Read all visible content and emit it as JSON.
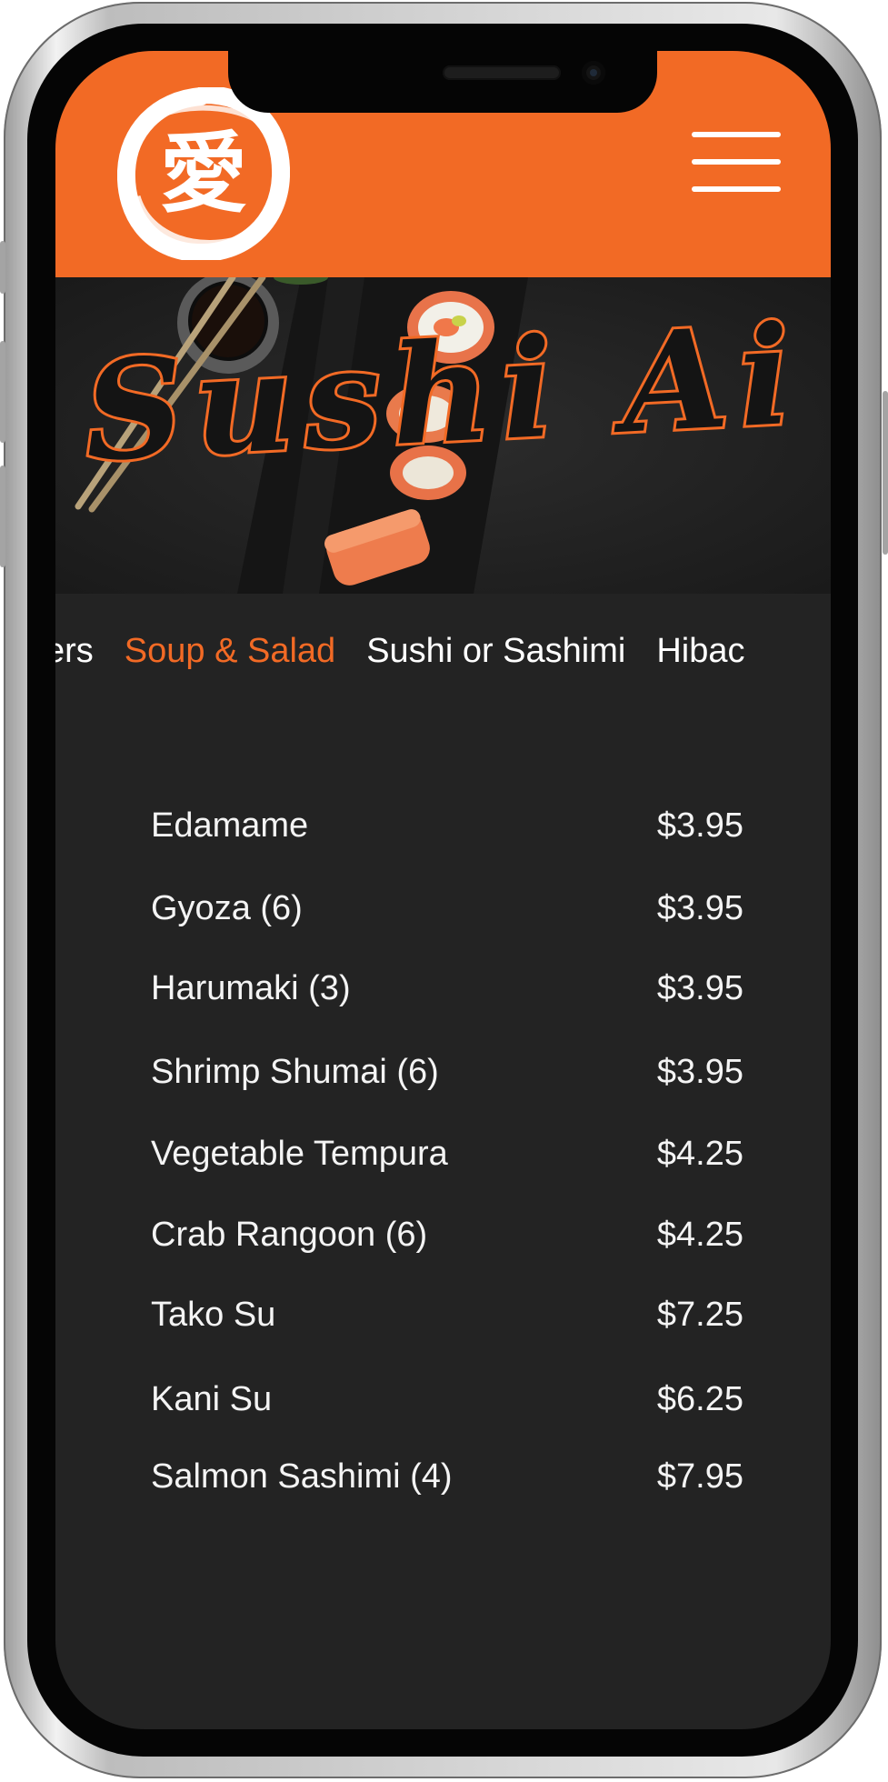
{
  "theme": {
    "accent": "#f26a25",
    "screen_bg": "#232323"
  },
  "header": {
    "logo_icon": "ai-kanji-brush-circle-logo",
    "menu_icon": "hamburger-menu-icon"
  },
  "hero": {
    "title": "Sushi Ai",
    "image_icon": "sushi-rolls-chopsticks-photo"
  },
  "tabs": [
    {
      "label": "Appetizers",
      "visible_text": "tizers",
      "active": false
    },
    {
      "label": "Soup & Salad",
      "active": true
    },
    {
      "label": "Sushi or Sashimi",
      "active": false
    },
    {
      "label": "Hibachi",
      "visible_text": "Hibac",
      "active": false
    }
  ],
  "menu_items": [
    {
      "name": "Edamame",
      "price": "$3.95"
    },
    {
      "name": "Gyoza (6)",
      "price": "$3.95"
    },
    {
      "name": "Harumaki (3)",
      "price": "$3.95"
    },
    {
      "name": "Shrimp Shumai (6)",
      "price": "$3.95"
    },
    {
      "name": "Vegetable Tempura",
      "price": "$4.25"
    },
    {
      "name": "Crab Rangoon (6)",
      "price": "$4.25"
    },
    {
      "name": "Tako Su",
      "price": "$7.25"
    },
    {
      "name": "Kani Su",
      "price": "$6.25"
    },
    {
      "name": "Salmon Sashimi (4)",
      "price": "$7.95"
    }
  ]
}
